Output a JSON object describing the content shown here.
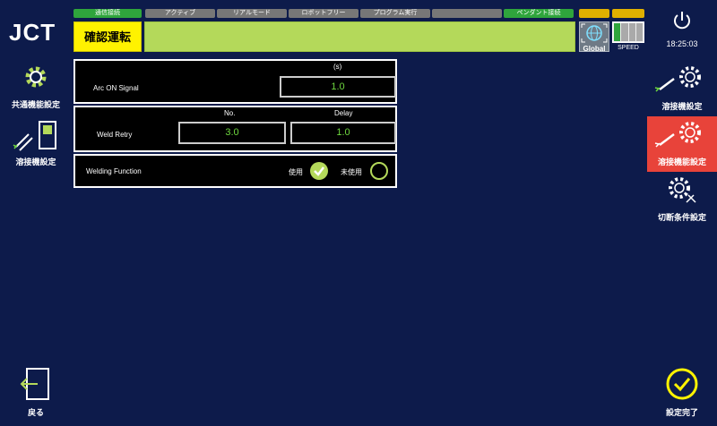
{
  "logo_text": "JCT",
  "status_tabs": [
    {
      "label": "通信接続",
      "state": "on"
    },
    {
      "label": "アクティブ",
      "state": "off"
    },
    {
      "label": "リアルモード",
      "state": "off"
    },
    {
      "label": "ロボットフリー",
      "state": "off"
    },
    {
      "label": "プログラム実行",
      "state": "off"
    },
    {
      "label": "",
      "state": "off"
    },
    {
      "label": "ペンダント接続",
      "state": "on"
    }
  ],
  "mode_label": "確認運転",
  "global_label": "Global",
  "speed_label": "SPEED",
  "clock": "18:25:03",
  "left_nav": [
    {
      "label": "共通機能設定",
      "icon": "gear-icon"
    },
    {
      "label": "溶接機設定",
      "icon": "welder-icon"
    }
  ],
  "right_nav": [
    {
      "label": "溶接機設定",
      "icon": "welding-gear-icon",
      "active": false
    },
    {
      "label": "溶接機能設定",
      "icon": "welding-function-icon",
      "active": true
    },
    {
      "label": "切断条件設定",
      "icon": "cutting-gear-icon",
      "active": false
    }
  ],
  "back_label": "戻る",
  "done_label": "設定完了",
  "arc_on": {
    "label": "Arc ON Signal",
    "unit": "(s)",
    "value": "1.0"
  },
  "weld_retry": {
    "label": "Weld Retry",
    "col_no": "No.",
    "col_delay": "Delay",
    "no_value": "3.0",
    "delay_value": "1.0"
  },
  "welding_function": {
    "label": "Welding Function",
    "use_label": "使用",
    "unuse_label": "未使用",
    "selected": "use"
  },
  "colors": {
    "background": "#0d1b4b",
    "accent_green": "#b4d95a",
    "mode_yellow": "#fff200",
    "active_red": "#e8433a",
    "value_green": "#6fd83f"
  }
}
